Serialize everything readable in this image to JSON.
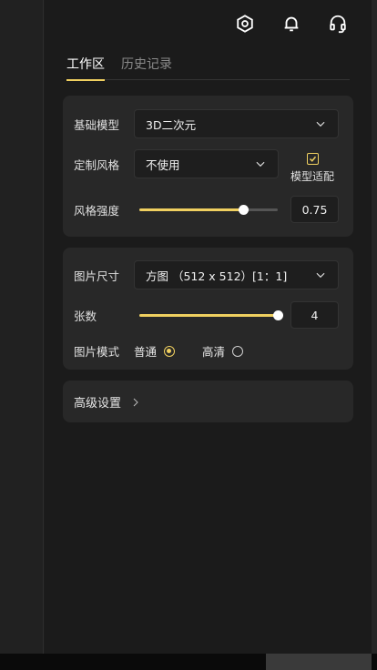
{
  "header": {
    "icons": [
      "settings-hex-icon",
      "bell-icon",
      "headset-icon"
    ]
  },
  "tabs": [
    {
      "label": "工作区",
      "active": true
    },
    {
      "label": "历史记录",
      "active": false
    }
  ],
  "settings": {
    "base_model": {
      "label": "基础模型",
      "value": "3D二次元"
    },
    "style": {
      "label": "定制风格",
      "value": "不使用",
      "checkbox_label": "模型适配",
      "checked": true
    },
    "style_strength": {
      "label": "风格强度",
      "value": "0.75",
      "fraction": 0.75
    }
  },
  "image": {
    "size": {
      "label": "图片尺寸",
      "value": "方图 （512 x 512）[1：1]"
    },
    "count": {
      "label": "张数",
      "value": "4",
      "fraction": 1.0
    },
    "mode": {
      "label": "图片模式",
      "options": [
        {
          "label": "普通",
          "selected": true
        },
        {
          "label": "高清",
          "selected": false
        }
      ]
    }
  },
  "advanced": {
    "label": "高级设置"
  },
  "colors": {
    "accent": "#f0d060",
    "panel": "#1b1b1b",
    "card": "#282828"
  }
}
